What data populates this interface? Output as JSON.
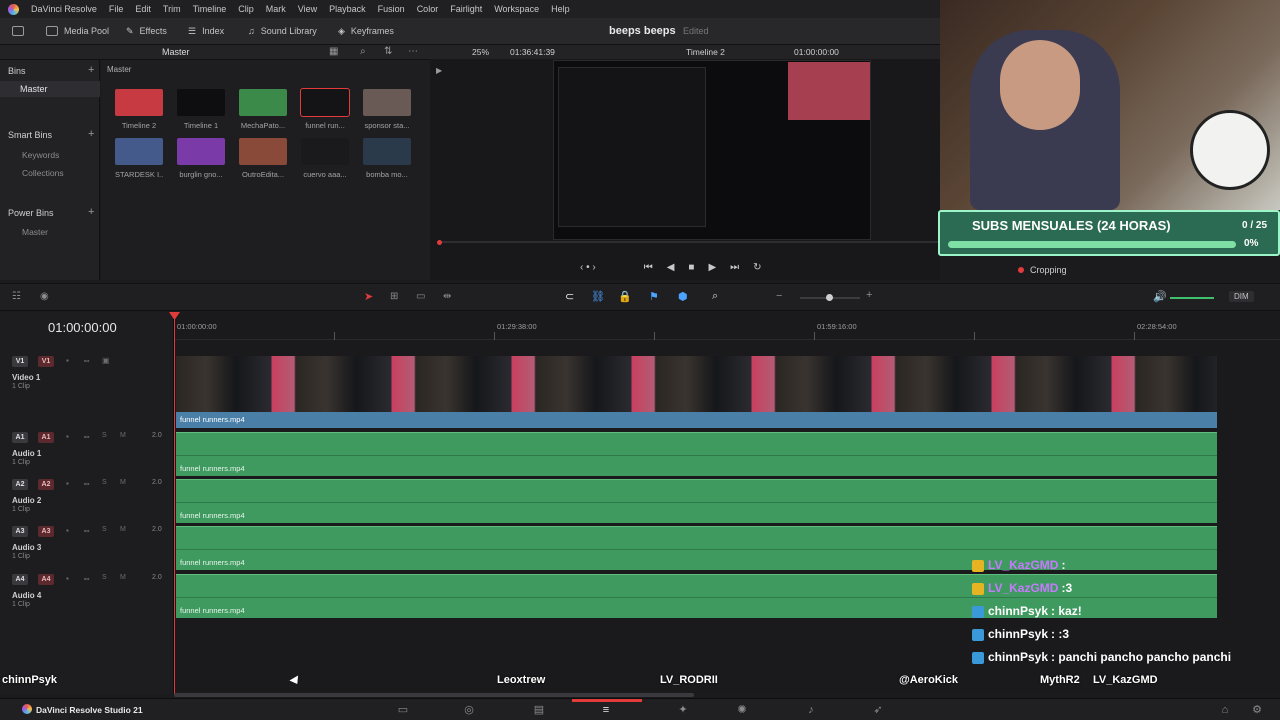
{
  "menubar": {
    "app": "DaVinci Resolve",
    "items": [
      "File",
      "Edit",
      "Trim",
      "Timeline",
      "Clip",
      "Mark",
      "View",
      "Playback",
      "Fusion",
      "Color",
      "Fairlight",
      "Workspace",
      "Help"
    ]
  },
  "toolbar": {
    "media_pool": "Media Pool",
    "effects": "Effects",
    "index": "Index",
    "sound_library": "Sound Library",
    "keyframes": "Keyframes",
    "project_title": "beeps beeps",
    "project_status": "Edited"
  },
  "media_pool": {
    "header": "Master",
    "breadcrumb": "Master",
    "bins_label": "Bins",
    "master_bin": "Master",
    "smart_bins_label": "Smart Bins",
    "smart_items": [
      "Keywords",
      "Collections"
    ],
    "power_bins_label": "Power Bins",
    "power_items": [
      "Master"
    ],
    "clips": [
      {
        "name": "Timeline 2",
        "color": "#c83a42"
      },
      {
        "name": "Timeline 1",
        "color": "#0e0e10"
      },
      {
        "name": "MechaPato...",
        "color": "#3b8a4a"
      },
      {
        "name": "funnel run...",
        "color": "#141416"
      },
      {
        "name": "sponsor sta...",
        "color": "#6a5a56"
      },
      {
        "name": "STARDESK I...",
        "color": "#445a8a"
      },
      {
        "name": "burglin gno...",
        "color": "#7a3aa8"
      },
      {
        "name": "OutroEdita...",
        "color": "#8a4a3a"
      },
      {
        "name": "cuervo aaa...",
        "color": "#1a1a1c"
      },
      {
        "name": "bomba mo...",
        "color": "#2a3a4a"
      }
    ]
  },
  "viewer": {
    "zoom": "25%",
    "source_timecode": "01:36:41:39",
    "timeline_name": "Timeline 2",
    "record_timecode": "01:00:00:00",
    "inspector_label": "Cropping"
  },
  "overlay": {
    "subs_title": "SUBS MENSUALES (24 HORAS)",
    "subs_count": "0 / 25",
    "subs_percent": "0%",
    "subs_progress": 0
  },
  "timeline": {
    "timecode": "01:00:00:00",
    "ruler": [
      "01:00:00:00",
      "01:29:38:00",
      "01:59:16:00",
      "02:28:54:00"
    ],
    "dim_label": "DIM",
    "tracks": [
      {
        "id": "V1",
        "name": "Video 1",
        "clips": "1 Clip",
        "clip": "funnel runners.mp4"
      },
      {
        "id": "A1",
        "name": "Audio 1",
        "clips": "1 Clip",
        "vol": "2.0",
        "clip": "funnel runners.mp4"
      },
      {
        "id": "A2",
        "name": "Audio 2",
        "clips": "1 Clip",
        "vol": "2.0",
        "clip": "funnel runners.mp4"
      },
      {
        "id": "A3",
        "name": "Audio 3",
        "clips": "1 Clip",
        "vol": "2.0",
        "clip": "funnel runners.mp4"
      },
      {
        "id": "A4",
        "name": "Audio 4",
        "clips": "1 Clip",
        "vol": "2.0",
        "clip": "funnel runners.mp4"
      }
    ],
    "solo": "S",
    "mute": "M"
  },
  "chat": [
    {
      "user": "LV_KazGMD",
      "msg": ":",
      "color": "#c879ff",
      "badge": "#e6b422"
    },
    {
      "user": "LV_KazGMD",
      "msg": ":3",
      "color": "#c879ff",
      "badge": "#e6b422"
    },
    {
      "user": "chinnPsyk",
      "msg": ": kaz!",
      "color": "#ffffff",
      "badge": "#3a9ad9"
    },
    {
      "user": "chinnPsyk",
      "msg": ": :3",
      "color": "#ffffff",
      "badge": "#3a9ad9"
    },
    {
      "user": "chinnPsyk",
      "msg": ": panchi pancho pancho panchi",
      "color": "#ffffff",
      "badge": "#3a9ad9"
    }
  ],
  "nameplates": [
    "chinnPsyk",
    "Leoxtrew",
    "LV_RODRII",
    "@AeroKick",
    "MythR2",
    "LV_KazGMD"
  ],
  "footer": {
    "app_name": "DaVinci Resolve Studio 21"
  },
  "colors": {
    "audio_clip": "#3f9a60",
    "video_clip_bar": "#4a80a8",
    "playhead": "#e23b3b",
    "subs_box": "#2b6a53"
  }
}
